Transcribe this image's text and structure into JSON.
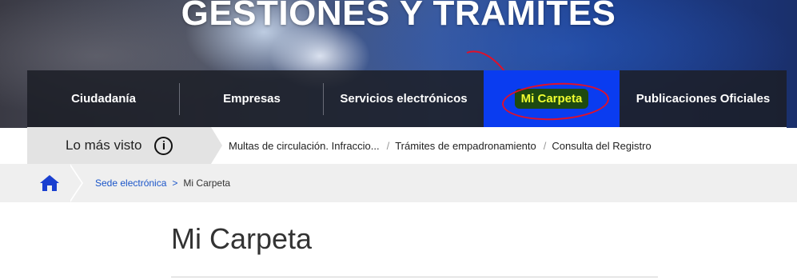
{
  "hero": {
    "title": "GESTIONES Y TRÁMITES"
  },
  "nav": {
    "items": [
      {
        "label": "Ciudadanía"
      },
      {
        "label": "Empresas"
      },
      {
        "label": "Servicios electrónicos"
      },
      {
        "label": "Mi Carpeta",
        "active": true
      },
      {
        "label": "Publicaciones Oficiales"
      }
    ],
    "active_color": "#0a3cf0"
  },
  "most_seen": {
    "label": "Lo más visto",
    "info_icon": "info-icon",
    "links": [
      "Multas de circulación. Infraccio...",
      "Trámites de empadronamiento",
      "Consulta del Registro"
    ],
    "separator": "/"
  },
  "breadcrumb": {
    "home_icon": "home-icon",
    "items": [
      {
        "label": "Sede electrónica"
      },
      {
        "label": "Mi Carpeta"
      }
    ],
    "separator": ">"
  },
  "page": {
    "title": "Mi Carpeta"
  }
}
